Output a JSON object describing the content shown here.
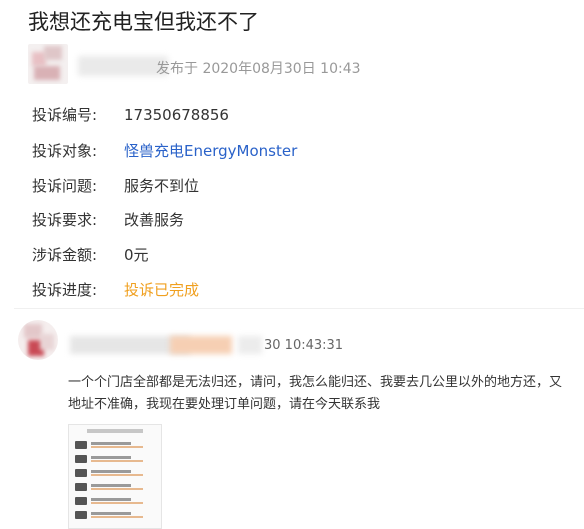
{
  "title": "我想还充电宝但我还不了",
  "author": {
    "published": "发布于 2020年08月30日 10:43"
  },
  "info": [
    {
      "label": "投诉编号:",
      "value": "17350678856",
      "style": ""
    },
    {
      "label": "投诉对象:",
      "value": "怪兽充电EnergyMonster",
      "style": "link"
    },
    {
      "label": "投诉问题:",
      "value": "服务不到位",
      "style": ""
    },
    {
      "label": "投诉要求:",
      "value": "改善服务",
      "style": ""
    },
    {
      "label": "涉诉金额:",
      "value": "0元",
      "style": ""
    },
    {
      "label": "投诉进度:",
      "value": "投诉已完成",
      "style": "orange"
    }
  ],
  "comment": {
    "time": "30 10:43:31",
    "text": "一个个门店全部都是无法归还，请问，我怎么能归还、我要去几公里以外的地方还，又地址不准确，我现在要处理订单问题，请在今天联系我"
  },
  "colors": {
    "link": "#2a62c9",
    "status": "#f0a020",
    "accent_blur": "#f6cfb3"
  }
}
